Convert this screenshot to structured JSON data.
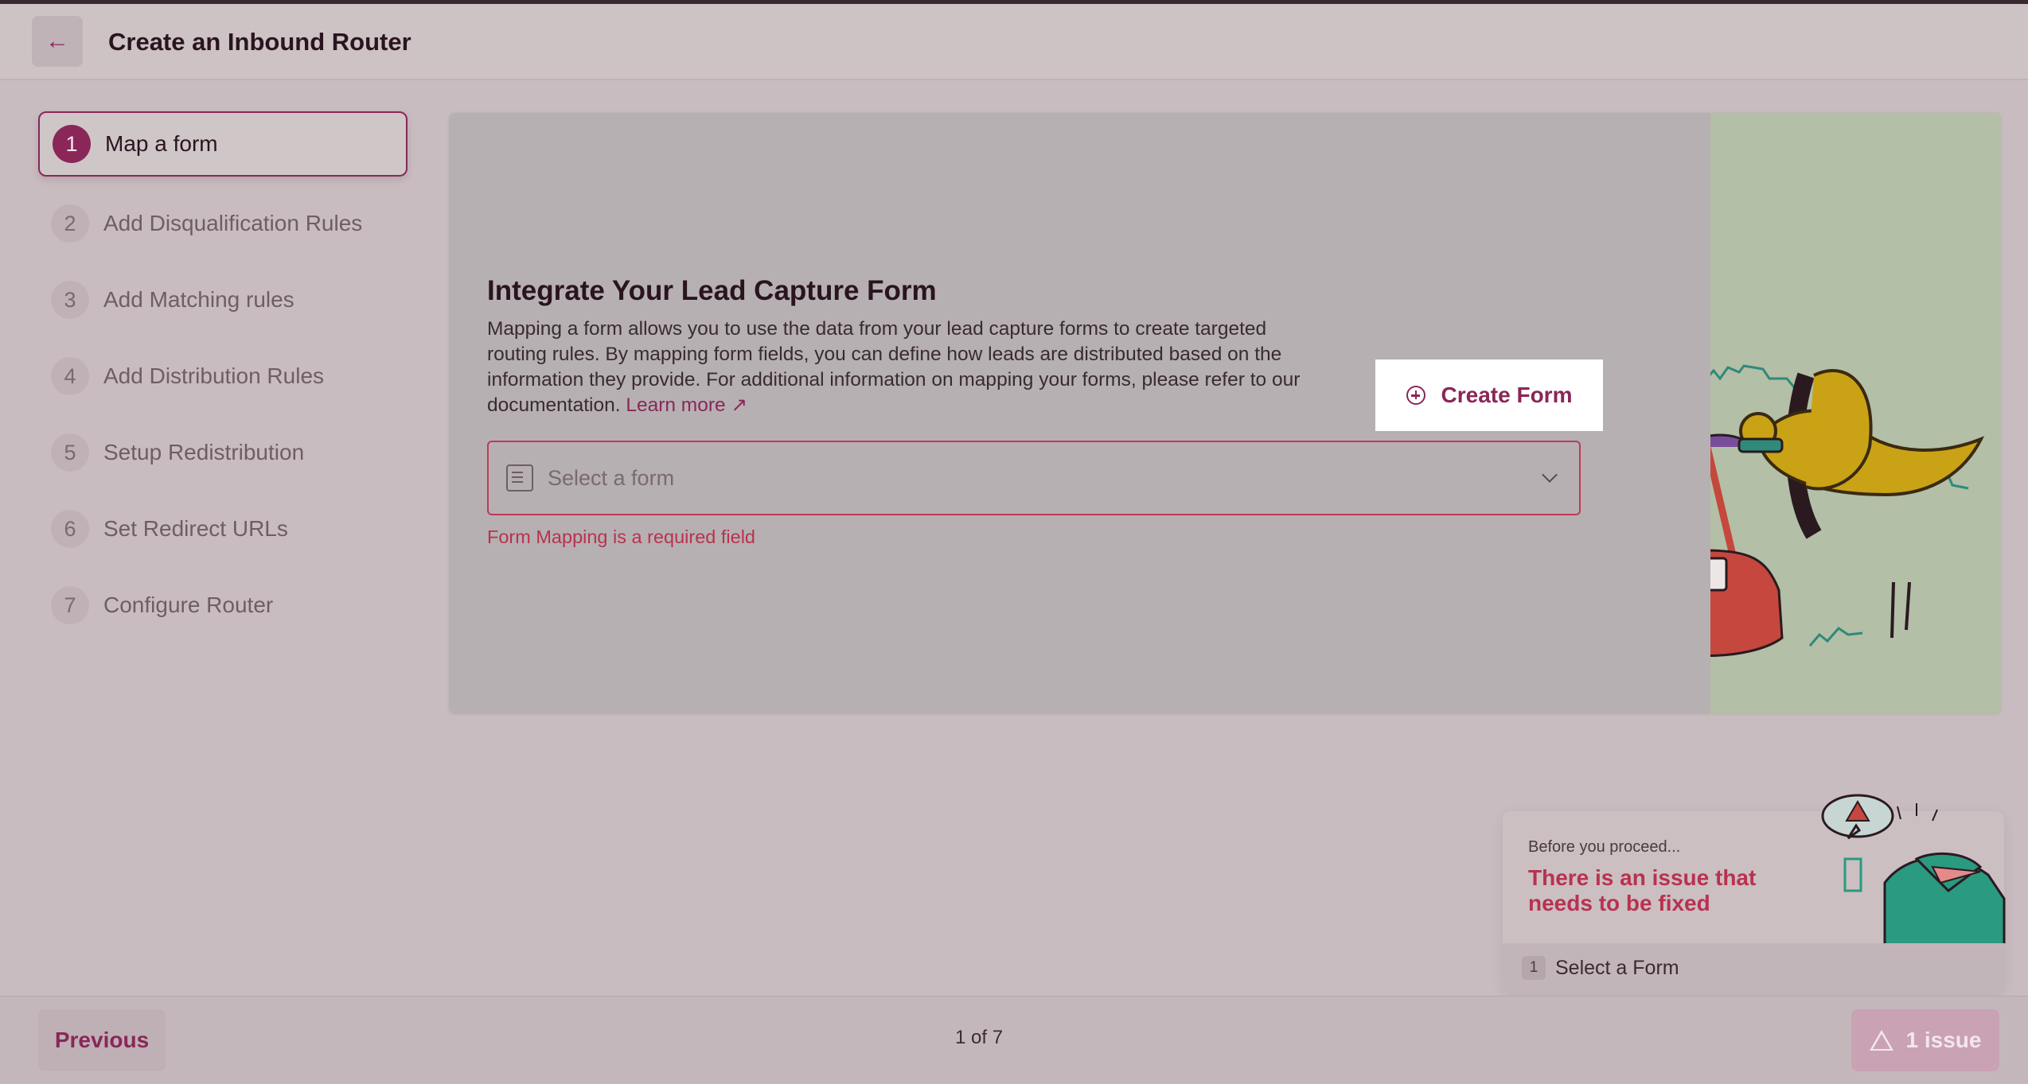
{
  "header": {
    "back_label": "←",
    "title": "Create an Inbound Router"
  },
  "steps": [
    {
      "num": "1",
      "label": "Map a form",
      "active": true
    },
    {
      "num": "2",
      "label": "Add Disqualification Rules"
    },
    {
      "num": "3",
      "label": "Add Matching rules"
    },
    {
      "num": "4",
      "label": "Add Distribution Rules"
    },
    {
      "num": "5",
      "label": "Setup Redistribution"
    },
    {
      "num": "6",
      "label": "Set Redirect URLs"
    },
    {
      "num": "7",
      "label": "Configure Router"
    }
  ],
  "main": {
    "title": "Integrate Your Lead Capture Form",
    "description": "Mapping a form allows you to use the data from your lead capture forms to create targeted routing rules. By mapping form fields, you can define how leads are distributed based on the information they provide. For additional information on mapping your forms, please refer to our documentation.",
    "learn_more": "Learn more ↗",
    "create_form_label": "Create Form",
    "select_placeholder": "Select a form",
    "error_text": "Form Mapping is a required field"
  },
  "issues_popover": {
    "pre": "Before you proceed...",
    "title": "There is an issue that needs to be fixed",
    "items": [
      {
        "num": "1",
        "label": "Select a Form"
      }
    ]
  },
  "footer": {
    "previous_label": "Previous",
    "page_indicator": "1 of 7",
    "issue_label": "1 issue"
  },
  "colors": {
    "brand": "#8a2758",
    "error": "#b8324f",
    "illustration_bg": "#b3bfa6"
  }
}
